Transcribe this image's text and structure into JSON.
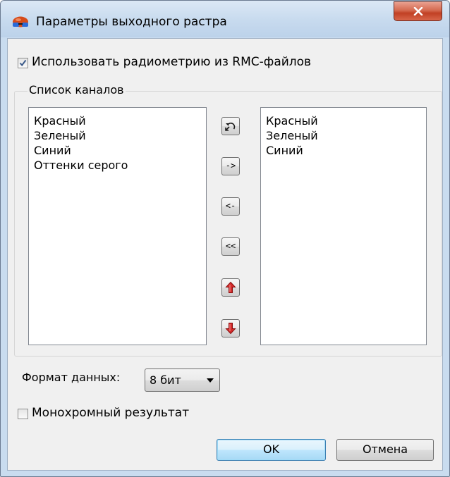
{
  "window": {
    "title": "Параметры выходного растра"
  },
  "options": {
    "use_radiometry_label": "Использовать радиометрию из RMC-файлов",
    "use_radiometry_checked": true,
    "monochrome_label": "Монохромный результат",
    "monochrome_checked": false
  },
  "channels": {
    "group_title": "Список каналов",
    "available": [
      "Красный",
      "Зеленый",
      "Синий",
      "Оттенки серого"
    ],
    "selected": [
      "Красный",
      "Зеленый",
      "Синий"
    ],
    "buttons": {
      "reset_icon": "undo-icon",
      "add": "->",
      "remove": "<-",
      "remove_all": "<<",
      "move_up_icon": "arrow-up-icon",
      "move_down_icon": "arrow-down-icon"
    }
  },
  "format": {
    "label": "Формат данных:",
    "value": "8 бит"
  },
  "footer": {
    "ok": "OK",
    "cancel": "Отмена"
  },
  "colors": {
    "accent": "#3c7fb1",
    "close": "#c14024",
    "arrow": "#d42a2a"
  }
}
